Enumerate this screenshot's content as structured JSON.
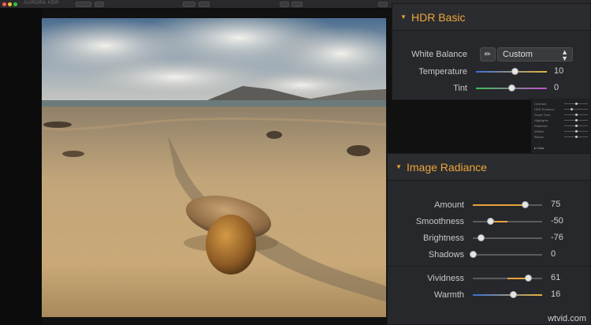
{
  "window": {
    "title": "AURORA HDR"
  },
  "hdr_basic": {
    "title": "HDR Basic",
    "white_balance": {
      "label": "White Balance",
      "value": "Custom",
      "icon": "eyedropper-icon"
    },
    "sliders": [
      {
        "label": "Temperature",
        "value": "10",
        "position": 0.55,
        "gradient": [
          "#3b6fd6",
          "#e2b43a"
        ]
      },
      {
        "label": "Tint",
        "value": "0",
        "position": 0.5,
        "gradient": [
          "#3fbf4f",
          "#c24fd2"
        ]
      }
    ]
  },
  "mini_panel": {
    "rows": [
      {
        "label": "Contrast",
        "position": 0.5
      },
      {
        "label": "HDR Enhance",
        "position": 0.3
      },
      {
        "label": "Smart Tone",
        "position": 0.5
      },
      {
        "label": "Highlights",
        "position": 0.5
      },
      {
        "label": "Shadows",
        "position": 0.5
      },
      {
        "label": "Whites",
        "position": 0.5
      },
      {
        "label": "Blacks",
        "position": 0.5
      }
    ],
    "section": "Color"
  },
  "image_radiance": {
    "title": "Image Radiance",
    "sliders": [
      {
        "label": "Amount",
        "value": "75",
        "position": 0.75,
        "fill": "#e6a43a",
        "centered": false
      },
      {
        "label": "Smoothness",
        "value": "-50",
        "position": 0.25,
        "fill": "#e6a43a",
        "centered": true
      },
      {
        "label": "Brightness",
        "value": "-76",
        "position": 0.12,
        "fill": "#5b5b5e",
        "centered": true
      },
      {
        "label": "Shadows",
        "value": "0",
        "position": 0.0,
        "fill": "#5b5b5e",
        "centered": false
      }
    ],
    "sliders2": [
      {
        "label": "Vividness",
        "value": "61",
        "position": 0.8,
        "fill": "#e6a43a",
        "centered": true
      },
      {
        "label": "Warmth",
        "value": "16",
        "position": 0.58,
        "fill": "#e6a43a",
        "gradient": [
          "#3b6fd6",
          "#e2b43a"
        ]
      }
    ]
  },
  "watermark": "wtvid.com",
  "colors": {
    "accent": "#eda63b",
    "panel": "#27282b"
  }
}
